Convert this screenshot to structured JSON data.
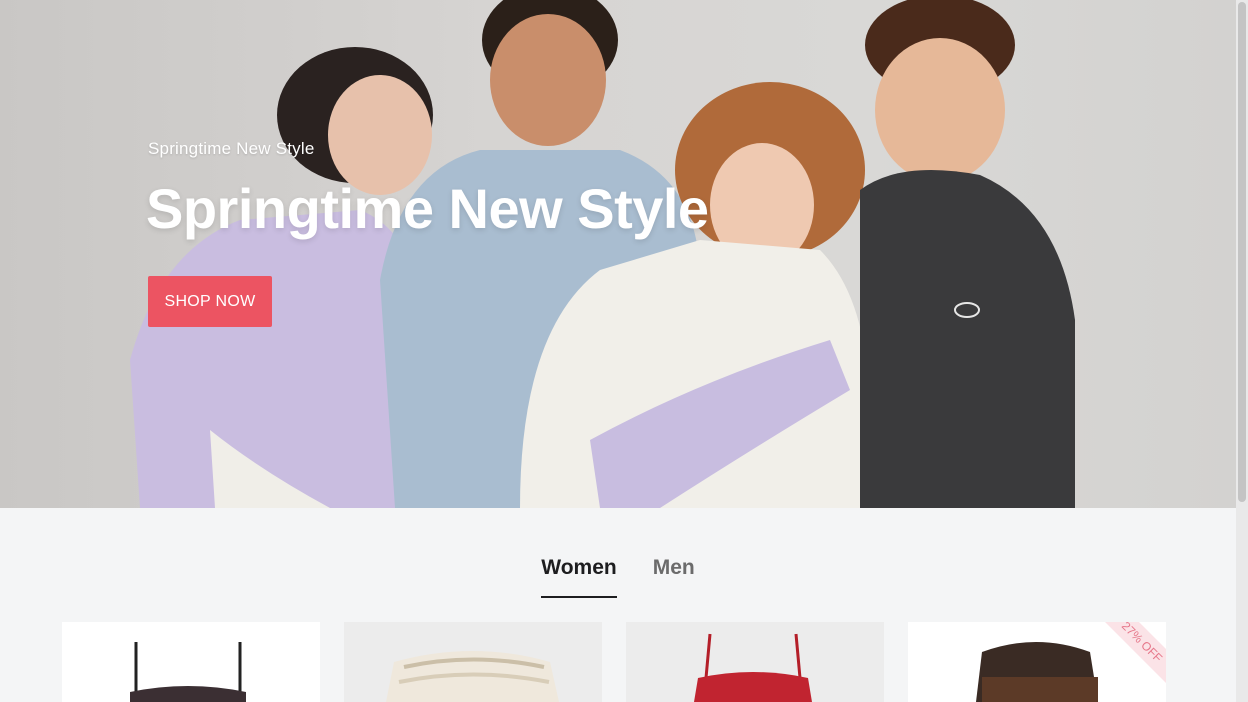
{
  "hero": {
    "subtitle": "Springtime New Style",
    "title": "Springtime New Style",
    "button_label": "SHOP NOW",
    "button_color": "#ec5462"
  },
  "tabs": [
    {
      "label": "Women",
      "active": true
    },
    {
      "label": "Men",
      "active": false
    }
  ],
  "products": [
    {
      "item": "camisole-top",
      "badge": ""
    },
    {
      "item": "ruffle-skirt",
      "badge": ""
    },
    {
      "item": "red-floral-cami",
      "badge": ""
    },
    {
      "item": "dark-sweater",
      "badge": "27% OFF"
    }
  ]
}
